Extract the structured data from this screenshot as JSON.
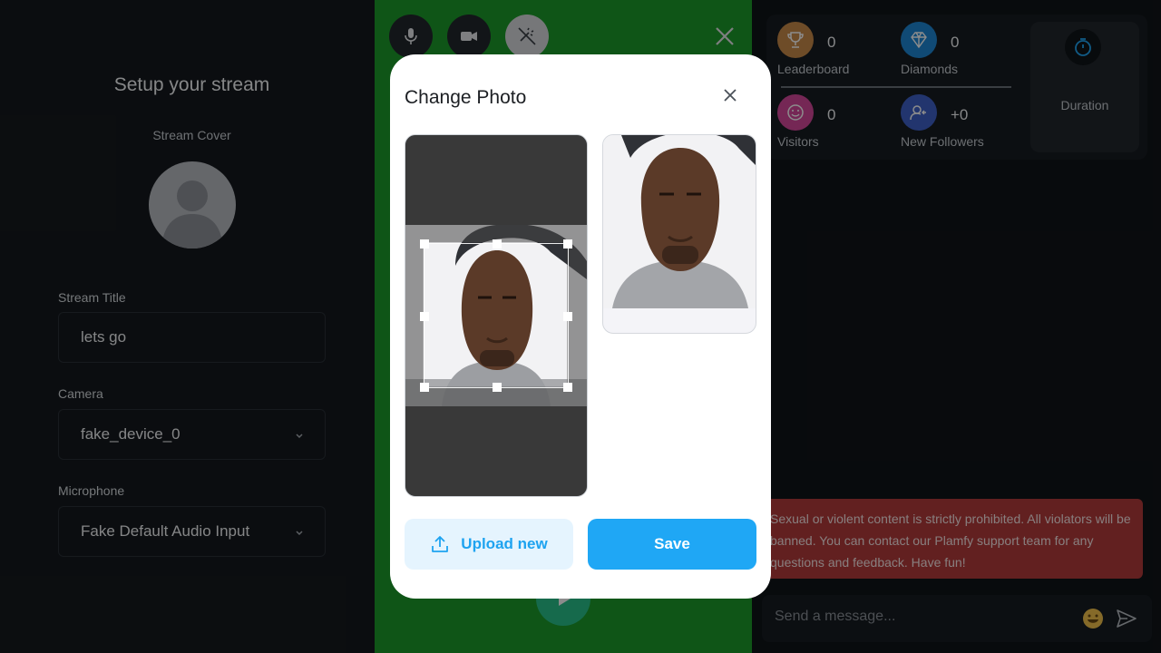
{
  "setup": {
    "title": "Setup your stream",
    "cover_label": "Stream Cover",
    "title_label": "Stream Title",
    "title_value": "lets go",
    "camera_label": "Camera",
    "camera_value": "fake_device_0",
    "mic_label": "Microphone",
    "mic_value": "Fake Default Audio Input"
  },
  "stats": {
    "leaderboard": {
      "value": "0",
      "label": "Leaderboard"
    },
    "diamonds": {
      "value": "0",
      "label": "Diamonds"
    },
    "visitors": {
      "value": "0",
      "label": "Visitors"
    },
    "followers": {
      "value": "+0",
      "label": "New Followers"
    },
    "duration_label": "Duration"
  },
  "chat": {
    "warning": "Sexual or violent content is strictly prohibited. All violators will be banned. You can contact our Plamfy support team for any questions and feedback. Have fun!",
    "placeholder": "Send a message..."
  },
  "modal": {
    "title": "Change Photo",
    "upload_label": "Upload new",
    "save_label": "Save"
  },
  "colors": {
    "accent": "#1fa7f5",
    "warning_bg": "#b23b3b",
    "video_bg": "#1d9b2a",
    "leaderboard_icon": "#c98a4a",
    "diamonds_icon": "#1e88d6",
    "visitors_icon": "#d6489c",
    "followers_icon": "#3f62c8"
  }
}
